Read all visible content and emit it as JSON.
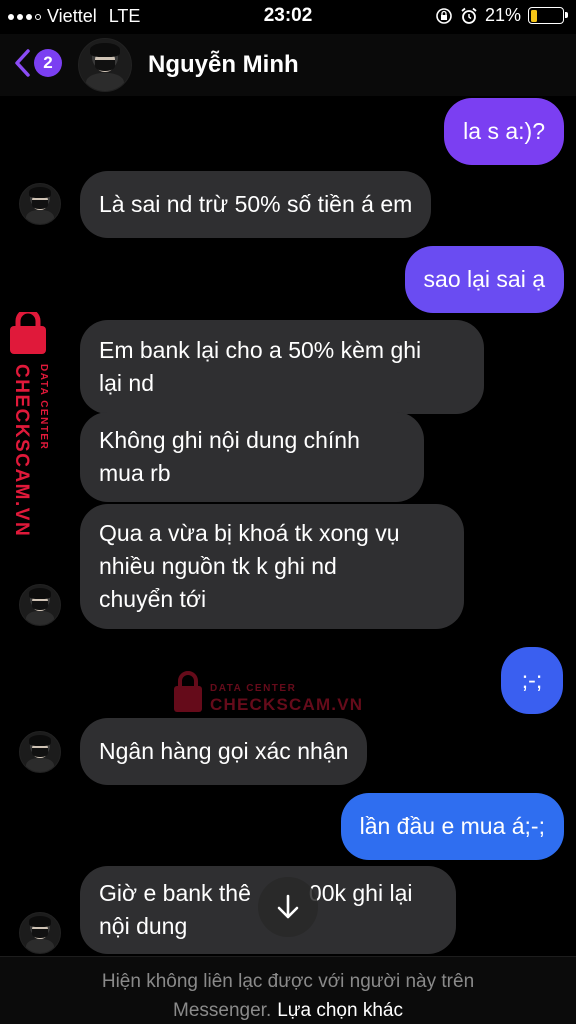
{
  "status_bar": {
    "carrier": "Viettel",
    "network": "LTE",
    "time": "23:02",
    "battery": "21%",
    "battery_level": 0.21,
    "icons": [
      "orientation-lock-icon",
      "alarm-icon"
    ]
  },
  "header": {
    "back_count": "2",
    "contact_name": "Nguyễn Minh"
  },
  "messages": [
    {
      "side": "outgoing",
      "text": "la s a:)?"
    },
    {
      "side": "incoming",
      "text": "Là sai nd trừ 50% số tiền á em"
    },
    {
      "side": "outgoing",
      "text": "sao lại sai ạ"
    },
    {
      "side": "incoming",
      "lines": [
        "Em bank lại cho a 50% kèm ghi",
        "lại nd"
      ]
    },
    {
      "side": "incoming",
      "lines": [
        "Không ghi nội dung chính",
        "mua rb"
      ]
    },
    {
      "side": "incoming",
      "lines": [
        "Qua a vừa bị khoá tk xong vụ",
        "nhiều nguồn tk k ghi nd",
        "chuyển tới"
      ]
    },
    {
      "side": "outgoing",
      "text": ";-;"
    },
    {
      "side": "incoming",
      "text": "Ngân hàng gọi xác nhận"
    },
    {
      "side": "outgoing",
      "text": "lần đầu e mua á;-;"
    },
    {
      "side": "incoming",
      "lines": [
        "Giờ e bank thê",
        "00k ghi lại",
        "nội dung"
      ]
    }
  ],
  "watermark": {
    "small": "DATA CENTER",
    "large": "CHECKSCAM.VN",
    "color": "#e0193a"
  },
  "footer": {
    "notice_line1": "Hiện không liên lạc được với người này trên",
    "notice_line2": "Messenger.",
    "choose_other": "Lựa chọn khác"
  },
  "colors": {
    "outgoing_purple": "#7b3ff2",
    "outgoing_violet": "#6a4cf2",
    "outgoing_blue": "#2f6ef0",
    "incoming": "#2f2f31"
  }
}
